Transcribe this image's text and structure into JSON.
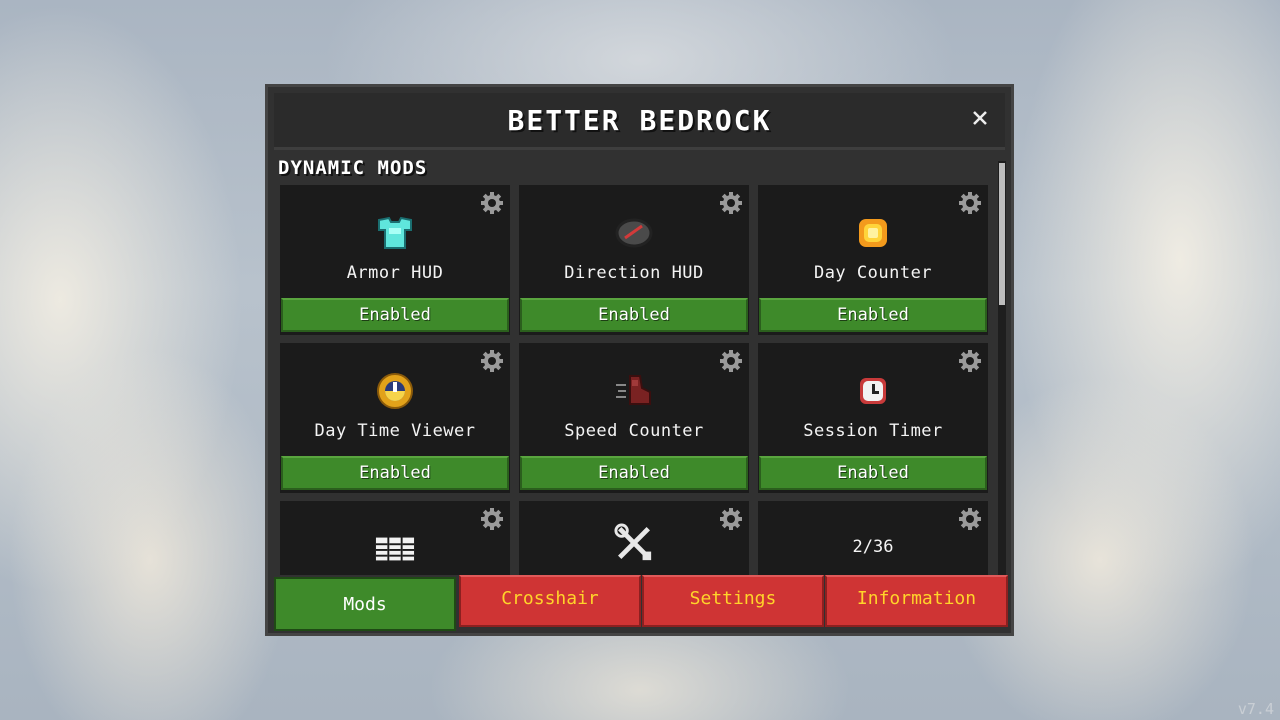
{
  "title": "BETTER BEDROCK",
  "section_title": "DYNAMIC MODS",
  "mods": [
    {
      "label": "Armor HUD",
      "status": "Enabled",
      "icon": "diamond-chestplate-icon"
    },
    {
      "label": "Direction HUD",
      "status": "Enabled",
      "icon": "compass-icon"
    },
    {
      "label": "Day Counter",
      "status": "Enabled",
      "icon": "sun-icon"
    },
    {
      "label": "Day Time Viewer",
      "status": "Enabled",
      "icon": "clock-icon"
    },
    {
      "label": "Speed Counter",
      "status": "Enabled",
      "icon": "speed-boot-icon"
    },
    {
      "label": "Session Timer",
      "status": "Enabled",
      "icon": "stopwatch-icon"
    }
  ],
  "partial_row": {
    "icons": [
      "keystrokes-icon",
      "tools-icon"
    ],
    "page_count": "2/36"
  },
  "tabs": [
    {
      "label": "Mods",
      "active": true
    },
    {
      "label": "Crosshair",
      "active": false
    },
    {
      "label": "Settings",
      "active": false
    },
    {
      "label": "Information",
      "active": false
    }
  ],
  "version": "v7.4",
  "colors": {
    "enabled_green": "#3e8a2a",
    "tab_red": "#cf3434",
    "tab_text_yellow": "#ffd42a",
    "panel_bg": "#313131",
    "card_bg": "#1b1b1b"
  }
}
